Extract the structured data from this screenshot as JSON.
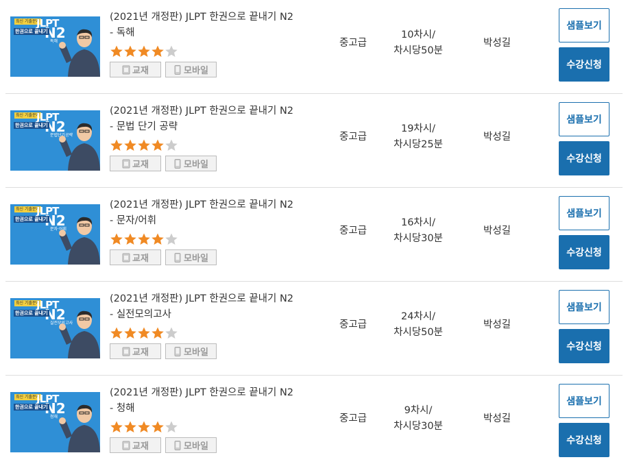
{
  "courses": [
    {
      "thumb": {
        "badge": "최신 기출문제",
        "brand": "JLPT",
        "level": "N2",
        "sub": "한권으로 끝내기",
        "tag": "독해"
      },
      "title_line1": "(2021년 개정판) JLPT 한권으로 끝내기 N2",
      "title_line2": "- 독해",
      "rating": 4,
      "tag_book": "교재",
      "tag_mobile": "모바일",
      "level": "중고급",
      "sessions_line1": "10차시/",
      "sessions_line2": "차시당50분",
      "teacher": "박성길",
      "sample_label": "샘플보기",
      "enroll_label": "수강신청"
    },
    {
      "thumb": {
        "badge": "최신 기출문제",
        "brand": "JLPT",
        "level": "N2",
        "sub": "한권으로 끝내기",
        "tag": "문법단기공략"
      },
      "title_line1": "(2021년 개정판) JLPT 한권으로 끝내기 N2",
      "title_line2": "- 문법 단기 공략",
      "rating": 4,
      "tag_book": "교재",
      "tag_mobile": "모바일",
      "level": "중고급",
      "sessions_line1": "19차시/",
      "sessions_line2": "차시당25분",
      "teacher": "박성길",
      "sample_label": "샘플보기",
      "enroll_label": "수강신청"
    },
    {
      "thumb": {
        "badge": "최신 기출문제",
        "brand": "JLPT",
        "level": "N2",
        "sub": "한권으로 끝내기",
        "tag": "문자·어휘"
      },
      "title_line1": "(2021년 개정판) JLPT 한권으로 끝내기 N2",
      "title_line2": "- 문자/어휘",
      "rating": 4,
      "tag_book": "교재",
      "tag_mobile": "모바일",
      "level": "중고급",
      "sessions_line1": "16차시/",
      "sessions_line2": "차시당30분",
      "teacher": "박성길",
      "sample_label": "샘플보기",
      "enroll_label": "수강신청"
    },
    {
      "thumb": {
        "badge": "최신 기출문제",
        "brand": "JLPT",
        "level": "N2",
        "sub": "한권으로 끝내기",
        "tag": "실전모의고사"
      },
      "title_line1": "(2021년 개정판) JLPT 한권으로 끝내기 N2",
      "title_line2": "- 실전모의고사",
      "rating": 4,
      "tag_book": "교재",
      "tag_mobile": "모바일",
      "level": "중고급",
      "sessions_line1": "24차시/",
      "sessions_line2": "차시당50분",
      "teacher": "박성길",
      "sample_label": "샘플보기",
      "enroll_label": "수강신청"
    },
    {
      "thumb": {
        "badge": "최신 기출문제",
        "brand": "JLPT",
        "level": "N2",
        "sub": "한권으로 끝내기",
        "tag": "청해"
      },
      "title_line1": "(2021년 개정판) JLPT 한권으로 끝내기 N2",
      "title_line2": "- 청해",
      "rating": 4,
      "tag_book": "교재",
      "tag_mobile": "모바일",
      "level": "중고급",
      "sessions_line1": "9차시/",
      "sessions_line2": "차시당30분",
      "teacher": "박성길",
      "sample_label": "샘플보기",
      "enroll_label": "수강신청"
    }
  ],
  "colors": {
    "accent": "#1a6fae",
    "thumb_bg": "#2f8fd6",
    "star_on": "#f08a24",
    "star_off": "#cccccc",
    "divider": "#dddddd"
  },
  "rating_max": 5
}
